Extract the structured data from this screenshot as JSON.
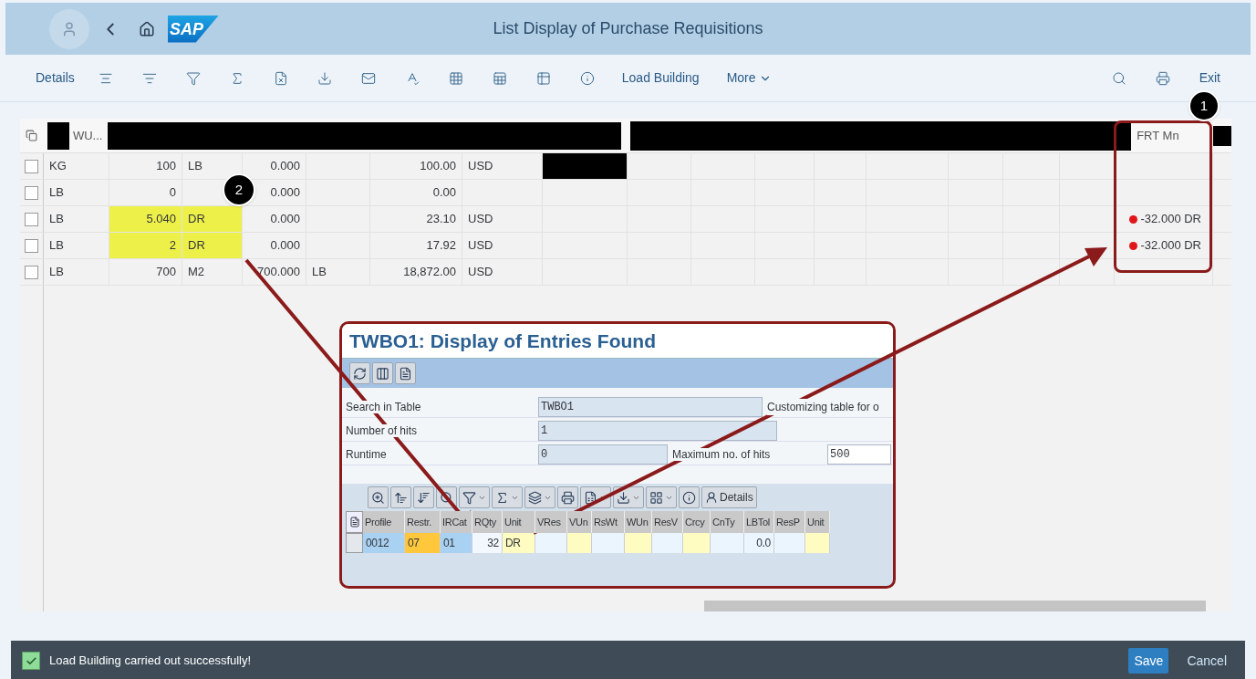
{
  "header": {
    "logo": "SAP",
    "title": "List Display of Purchase Requisitions"
  },
  "toolbar": {
    "details": "Details",
    "load_building": "Load Building",
    "more": "More",
    "exit": "Exit"
  },
  "table": {
    "columns": [
      "WU...",
      "FRT Mn"
    ],
    "rows": [
      {
        "checked": false,
        "highlighted": false,
        "redacted": true,
        "frt_error": false,
        "cells": [
          "KG",
          "100",
          "LB",
          "0.000",
          null,
          "100.00",
          "USD"
        ],
        "frt": null
      },
      {
        "checked": false,
        "highlighted": false,
        "redacted": false,
        "frt_error": false,
        "cells": [
          "LB",
          "0",
          null,
          "0.000",
          null,
          "0.00",
          null
        ],
        "frt": null
      },
      {
        "checked": false,
        "highlighted": true,
        "redacted": false,
        "frt_error": true,
        "cells": [
          "LB",
          "5.040",
          "DR",
          "0.000",
          null,
          "23.10",
          "USD"
        ],
        "frt": "-32.000 DR"
      },
      {
        "checked": false,
        "highlighted": true,
        "redacted": false,
        "frt_error": true,
        "cells": [
          "LB",
          "2",
          "DR",
          "0.000",
          null,
          "17.92",
          "USD"
        ],
        "frt": "-32.000 DR"
      },
      {
        "checked": false,
        "highlighted": false,
        "redacted": false,
        "frt_error": false,
        "cells": [
          "LB",
          "700",
          "M2",
          "700.000",
          "LB",
          "18,872.00",
          "USD"
        ],
        "frt": null
      }
    ]
  },
  "callouts": [
    "1",
    "2"
  ],
  "popup": {
    "title": "TWBO1: Display of Entries Found",
    "fields": [
      {
        "label": "Search in Table",
        "value": "TWBO1",
        "note": "Customizing table for o"
      },
      {
        "label": "Number of hits",
        "value": "1"
      },
      {
        "label": "Runtime",
        "value": "0",
        "extra_label": "Maximum no. of hits",
        "extra_value": "500"
      }
    ],
    "details_button": "Details",
    "results": {
      "columns": [
        "Profile",
        "Restr.",
        "IRCat",
        "RQty",
        "Unit",
        "VRes",
        "VUn",
        "RsWt",
        "WUn",
        "ResV",
        "Crcy",
        "CnTy",
        "LBTol",
        "ResP",
        "Unit"
      ],
      "row": [
        {
          "text": "0012",
          "color": "#a9d1f2"
        },
        {
          "text": "07",
          "color": "#ffc83c"
        },
        {
          "text": "01",
          "color": "#a9d1f2"
        },
        {
          "text": "32",
          "color": "#f2f8fd"
        },
        {
          "text": "DR",
          "color": "#fefcc0"
        },
        {
          "color": "#eaf5fd"
        },
        {
          "color": "#fefcc0"
        },
        {
          "color": "#eaf5fd"
        },
        {
          "color": "#fefcc0"
        },
        {
          "color": "#eaf5fd"
        },
        {
          "color": "#fefcc0"
        },
        {
          "color": "#eaf5fd"
        },
        {
          "text": "0.0",
          "color": "#eaf5fd"
        },
        {
          "color": "#eaf5fd"
        },
        {
          "color": "#fefcc0"
        }
      ]
    }
  },
  "footer": {
    "message": "Load Building carried out successfully!",
    "save": "Save",
    "cancel": "Cancel"
  }
}
